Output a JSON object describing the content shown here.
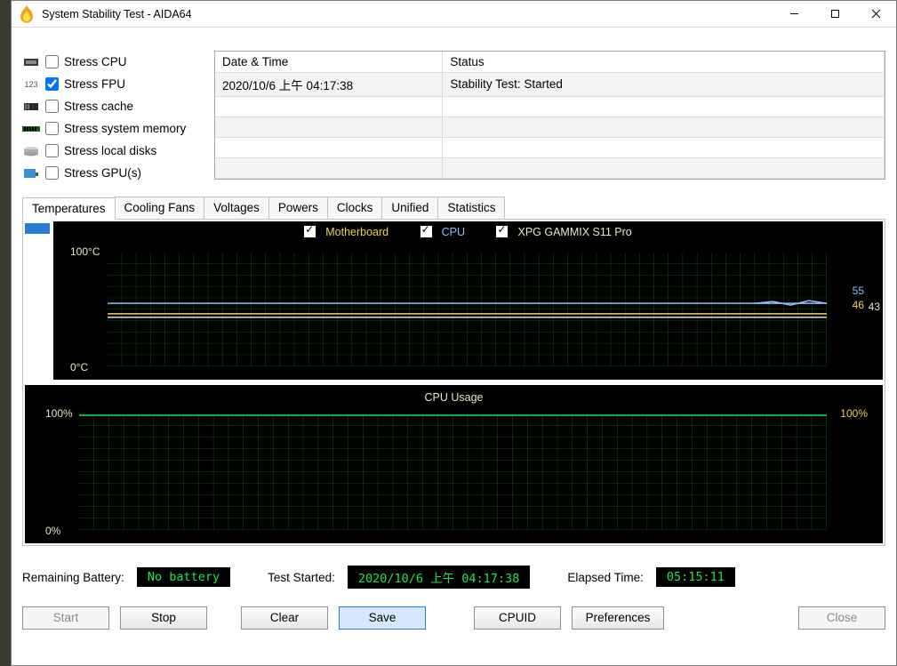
{
  "window_title": "System Stability Test - AIDA64",
  "checks": [
    {
      "label": "Stress CPU",
      "checked": false
    },
    {
      "label": "Stress FPU",
      "checked": true
    },
    {
      "label": "Stress cache",
      "checked": false
    },
    {
      "label": "Stress system memory",
      "checked": false
    },
    {
      "label": "Stress local disks",
      "checked": false
    },
    {
      "label": "Stress GPU(s)",
      "checked": false
    }
  ],
  "grid": {
    "headers": [
      "Date & Time",
      "Status"
    ],
    "rows": [
      {
        "datetime": "2020/10/6 上午 04:17:38",
        "status": "Stability Test: Started"
      }
    ]
  },
  "tabs": [
    "Temperatures",
    "Cooling Fans",
    "Voltages",
    "Powers",
    "Clocks",
    "Unified",
    "Statistics"
  ],
  "active_tab": "Temperatures",
  "chart_data": [
    {
      "type": "line",
      "title": "",
      "ylabel": "°C",
      "ylim": [
        0,
        100
      ],
      "yhigh": "100°C",
      "ylow": "0°C",
      "series": [
        {
          "name": "Motherboard",
          "color": "#f2d24b",
          "current": 46
        },
        {
          "name": "CPU",
          "color": "#8fc0ff",
          "current": 55
        },
        {
          "name": "XPG GAMMIX S11 Pro",
          "color": "#e6e6c8",
          "current": 43
        }
      ]
    },
    {
      "type": "line",
      "title": "CPU Usage",
      "yhigh": "100%",
      "ylow": "0%",
      "ylim": [
        0,
        100
      ],
      "current": 100,
      "current_label": "100%"
    }
  ],
  "status": {
    "battery_label": "Remaining Battery:",
    "battery_value": "No battery",
    "started_label": "Test Started:",
    "started_value": "2020/10/6 上午 04:17:38",
    "elapsed_label": "Elapsed Time:",
    "elapsed_value": "05:15:11"
  },
  "buttons": {
    "start": "Start",
    "stop": "Stop",
    "clear": "Clear",
    "save": "Save",
    "cpuid": "CPUID",
    "prefs": "Preferences",
    "close": "Close"
  }
}
